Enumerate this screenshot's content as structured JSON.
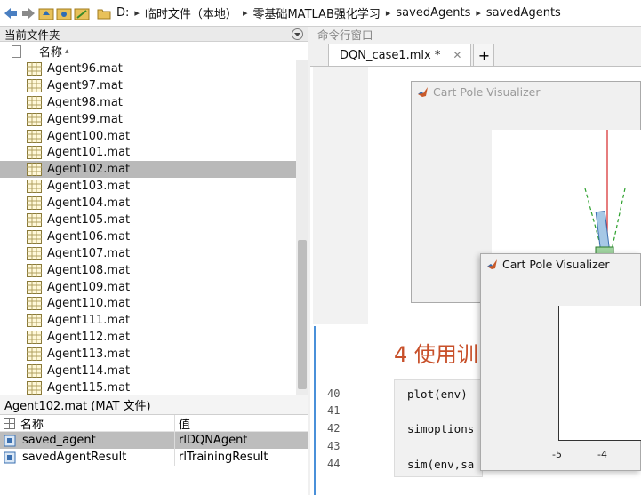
{
  "address_bar": {
    "path": [
      "D:",
      "临时文件（本地）",
      "零基础MATLAB强化学习",
      "savedAgents",
      "savedAgents"
    ]
  },
  "current_folder": {
    "title": "当前文件夹",
    "column_name": "名称",
    "sort_indicator": "▴",
    "files": [
      "Agent96.mat",
      "Agent97.mat",
      "Agent98.mat",
      "Agent99.mat",
      "Agent100.mat",
      "Agent101.mat",
      "Agent102.mat",
      "Agent103.mat",
      "Agent104.mat",
      "Agent105.mat",
      "Agent106.mat",
      "Agent107.mat",
      "Agent108.mat",
      "Agent109.mat",
      "Agent110.mat",
      "Agent111.mat",
      "Agent112.mat",
      "Agent113.mat",
      "Agent114.mat",
      "Agent115.mat"
    ],
    "selected_index": 6
  },
  "details": {
    "title": "Agent102.mat (MAT 文件)",
    "col_name": "名称",
    "col_value": "值",
    "rows": [
      {
        "name": "saved_agent",
        "value": "rlDQNAgent"
      },
      {
        "name": "savedAgentResult",
        "value": "rlTrainingResult"
      }
    ]
  },
  "command_window": {
    "title": "命令行窗口"
  },
  "editor": {
    "tab_label": "DQN_case1.mlx *",
    "tab_close": "✕",
    "add_tab": "+",
    "heading": "4 使用训",
    "line_numbers": [
      "40",
      "41",
      "42",
      "43",
      "44"
    ],
    "code_lines": [
      "plot(env)",
      "",
      "simoptions",
      "",
      "sim(env,sa"
    ]
  },
  "figures": {
    "fig1_title": "Cart Pole Visualizer",
    "fig2_title": "Cart Pole Visualizer",
    "fig2_ticks": [
      "-5",
      "-4"
    ]
  },
  "colors": {
    "heading": "#c8502a",
    "pole_fill": "#a6c8e6",
    "pole_red": "#d62728",
    "bound_green": "#2ca02c",
    "selection": "#b9b9b9"
  }
}
